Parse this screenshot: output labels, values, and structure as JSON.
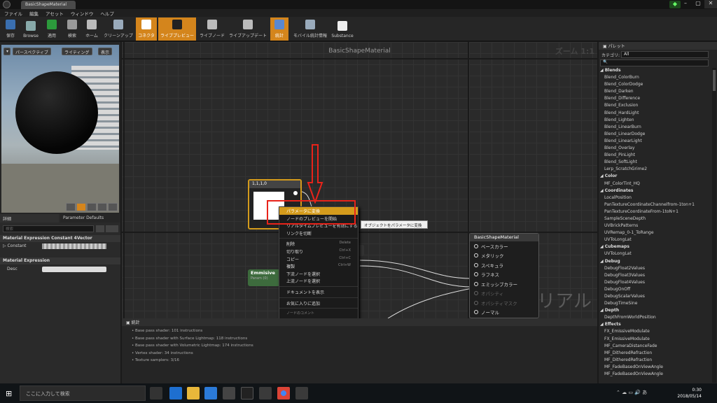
{
  "window": {
    "tab_title": "BasicShapeMaterial"
  },
  "menu": [
    "ファイル",
    "編集",
    "アセット",
    "ウィンドウ",
    "ヘルプ"
  ],
  "toolbar": [
    {
      "label": "保存",
      "icon": "save-icon",
      "active": false
    },
    {
      "label": "Browse",
      "icon": "browse-icon",
      "active": false
    },
    {
      "label": "適用",
      "icon": "apply-icon",
      "active": false
    },
    {
      "label": "検索",
      "icon": "search-icon",
      "active": false
    },
    {
      "label": "ホーム",
      "icon": "home-icon",
      "active": false
    },
    {
      "label": "クリーンアップ",
      "icon": "cleanup-icon",
      "active": false
    },
    {
      "label": "コネクタ",
      "icon": "connector-icon",
      "active": true
    },
    {
      "label": "ライブプレビュー",
      "icon": "live-preview-icon",
      "active": true
    },
    {
      "label": "ライブノード",
      "icon": "live-node-icon",
      "active": false
    },
    {
      "label": "ライブアップデート",
      "icon": "live-update-icon",
      "active": false
    },
    {
      "label": "統計",
      "icon": "stats-icon",
      "active": true
    },
    {
      "label": "モバイル統計情報",
      "icon": "mobile-stats-icon",
      "active": false
    },
    {
      "label": "Substance",
      "icon": "substance-icon",
      "active": false
    }
  ],
  "viewport": {
    "perspective": "パースペクティブ",
    "lighting": "ライティング",
    "show": "表示"
  },
  "details": {
    "tab_details": "詳細",
    "tab_params": "Parameter Defaults",
    "search_placeholder": "検索",
    "section1": "Material Expression Constant 4Vector",
    "constant_label": "Constant",
    "section2": "Material Expression",
    "desc_label": "Desc"
  },
  "graph": {
    "title": "BasicShapeMaterial",
    "zoom": "ズーム 1:1",
    "watermark": "マテリアル",
    "const_node_title": "1,1,1,0",
    "emissive_title": "Emmisive",
    "emissive_sub": "Param (0)",
    "material_node_title": "BasicShapeMaterial",
    "material_pins": [
      {
        "label": "ベースカラー",
        "dim": false
      },
      {
        "label": "メタリック",
        "dim": false
      },
      {
        "label": "スペキュラ",
        "dim": false
      },
      {
        "label": "ラフネス",
        "dim": false
      },
      {
        "label": "エミッシブカラー",
        "dim": false
      },
      {
        "label": "オパシティ",
        "dim": true
      },
      {
        "label": "オパシティマスク",
        "dim": true
      },
      {
        "label": "ノーマル",
        "dim": false
      }
    ]
  },
  "context_menu": {
    "items": [
      {
        "label": "パラメータに変換",
        "shortcut": "",
        "highlight": true
      },
      {
        "label": "ノードのプレビューを開始",
        "shortcut": ""
      },
      {
        "label": "リアルタイムプレビューを有効にする",
        "shortcut": ""
      },
      {
        "label": "リンクを切断",
        "shortcut": ""
      },
      {
        "sep": true
      },
      {
        "label": "削除",
        "shortcut": "Delete"
      },
      {
        "label": "切り取り",
        "shortcut": "Ctrl+X"
      },
      {
        "label": "コピー",
        "shortcut": "Ctrl+C"
      },
      {
        "label": "複製",
        "shortcut": "Ctrl+W"
      },
      {
        "label": "下流ノードを選択",
        "shortcut": ""
      },
      {
        "label": "上流ノードを選択",
        "shortcut": ""
      },
      {
        "sep": true
      },
      {
        "label": "ドキュメントを表示",
        "shortcut": ""
      },
      {
        "sep": true
      },
      {
        "label": "お気に入りに追加",
        "shortcut": ""
      },
      {
        "sep": true
      },
      {
        "label": "ノードのコメント",
        "shortcut": "",
        "small": true
      }
    ],
    "tooltip": "オブジェクトをパラメータに変換"
  },
  "stats": {
    "title": "統計",
    "lines": [
      "Base pass shader: 101 instructions",
      "Base pass shader with Surface Lightmap: 118 instructions",
      "Base pass shader with Volumetric Lightmap: 174 instructions",
      "Vertex shader: 34 instructions",
      "Texture samplers: 3/16"
    ]
  },
  "palette": {
    "title": "パレット",
    "category_label": "カテゴリ:",
    "category_value": "All",
    "items": [
      {
        "t": "Blends",
        "cat": true
      },
      {
        "t": "Blend_ColorBurn"
      },
      {
        "t": "Blend_ColorDodge"
      },
      {
        "t": "Blend_Darken"
      },
      {
        "t": "Blend_Difference"
      },
      {
        "t": "Blend_Exclusion"
      },
      {
        "t": "Blend_HardLight"
      },
      {
        "t": "Blend_Lighten"
      },
      {
        "t": "Blend_LinearBurn"
      },
      {
        "t": "Blend_LinearDodge"
      },
      {
        "t": "Blend_LinearLight"
      },
      {
        "t": "Blend_Overlay"
      },
      {
        "t": "Blend_PinLight"
      },
      {
        "t": "Blend_SoftLight"
      },
      {
        "t": "Lerp_ScratchGrime2"
      },
      {
        "t": "Color",
        "cat": true
      },
      {
        "t": "MF_ColorTint_HQ"
      },
      {
        "t": "Coordinates",
        "cat": true
      },
      {
        "t": "LocalPosition"
      },
      {
        "t": "PanTextureCoordinateChannelfrom-1ton+1"
      },
      {
        "t": "PanTextureCoordinateFrom-1toN+1"
      },
      {
        "t": "SampleSceneDepth"
      },
      {
        "t": "UVBrickPatterns"
      },
      {
        "t": "UVRemap_0-1_ToRange"
      },
      {
        "t": "UVToLongLat"
      },
      {
        "t": "Cubemaps",
        "cat": true
      },
      {
        "t": "UVToLongLat"
      },
      {
        "t": "Debug",
        "cat": true
      },
      {
        "t": "DebugFloat2Values"
      },
      {
        "t": "DebugFloat3Values"
      },
      {
        "t": "DebugFloat4Values"
      },
      {
        "t": "DebugOnOff"
      },
      {
        "t": "DebugScalarValues"
      },
      {
        "t": "DebugTimeSine"
      },
      {
        "t": "Depth",
        "cat": true
      },
      {
        "t": "DepthFromWorldPosition"
      },
      {
        "t": "Effects",
        "cat": true
      },
      {
        "t": "FX_EmissiveModulate"
      },
      {
        "t": "FX_EmissiveModulate"
      },
      {
        "t": "MF_CameraDistanceFade"
      },
      {
        "t": "MF_DitheredRefraction"
      },
      {
        "t": "MF_DitheredRefraction"
      },
      {
        "t": "MF_FadeBasedOnViewAngle"
      },
      {
        "t": "MF_FadeBasedOnViewAngle"
      }
    ]
  },
  "taskbar": {
    "search_placeholder": "ここに入力して検索",
    "time": "0:30",
    "date": "2018/05/14"
  }
}
